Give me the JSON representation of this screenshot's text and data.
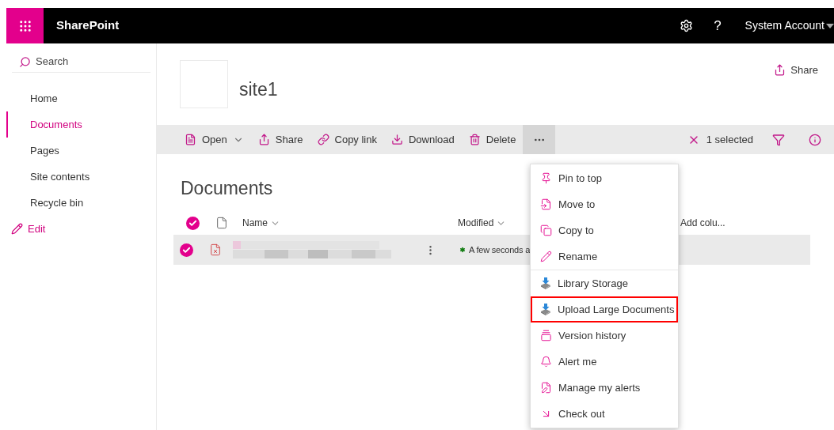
{
  "suite_bar": {
    "app_name": "SharePoint",
    "help": "?",
    "user": "System Account"
  },
  "sidebar": {
    "search_placeholder": "Search",
    "items": [
      {
        "label": "Home",
        "selected": false
      },
      {
        "label": "Documents",
        "selected": true
      },
      {
        "label": "Pages",
        "selected": false
      },
      {
        "label": "Site contents",
        "selected": false
      },
      {
        "label": "Recycle bin",
        "selected": false
      }
    ],
    "edit": "Edit"
  },
  "site": {
    "title": "site1",
    "share": "Share"
  },
  "command_bar": {
    "commands": [
      {
        "kind": "open",
        "label": "Open"
      },
      {
        "kind": "share",
        "label": "Share"
      },
      {
        "kind": "link",
        "label": "Copy link"
      },
      {
        "kind": "download",
        "label": "Download"
      },
      {
        "kind": "delete",
        "label": "Delete"
      }
    ],
    "more_expanded": true,
    "selection": "1 selected"
  },
  "library": {
    "title": "Documents",
    "all_selected": true,
    "columns": [
      "Name",
      "Modified",
      "Add colu..."
    ],
    "rows": [
      {
        "selected": true,
        "modified": "A few seconds a",
        "is_new": true
      }
    ]
  },
  "more_menu": {
    "sections": [
      [
        {
          "kind": "pin",
          "label": "Pin to top",
          "highlighted": false
        },
        {
          "kind": "move",
          "label": "Move to",
          "highlighted": false
        },
        {
          "kind": "copy",
          "label": "Copy to",
          "highlighted": false
        },
        {
          "kind": "rename",
          "label": "Rename",
          "highlighted": false
        }
      ],
      [
        {
          "kind": "storage",
          "label": "Library Storage",
          "highlighted": false
        },
        {
          "kind": "storage",
          "label": "Upload Large Documents",
          "highlighted": true
        },
        {
          "kind": "versions",
          "label": "Version history",
          "highlighted": false
        },
        {
          "kind": "alert",
          "label": "Alert me",
          "highlighted": false
        },
        {
          "kind": "alerts",
          "label": "Manage my alerts",
          "highlighted": false
        },
        {
          "kind": "checkout",
          "label": "Check out",
          "highlighted": false
        }
      ]
    ]
  }
}
